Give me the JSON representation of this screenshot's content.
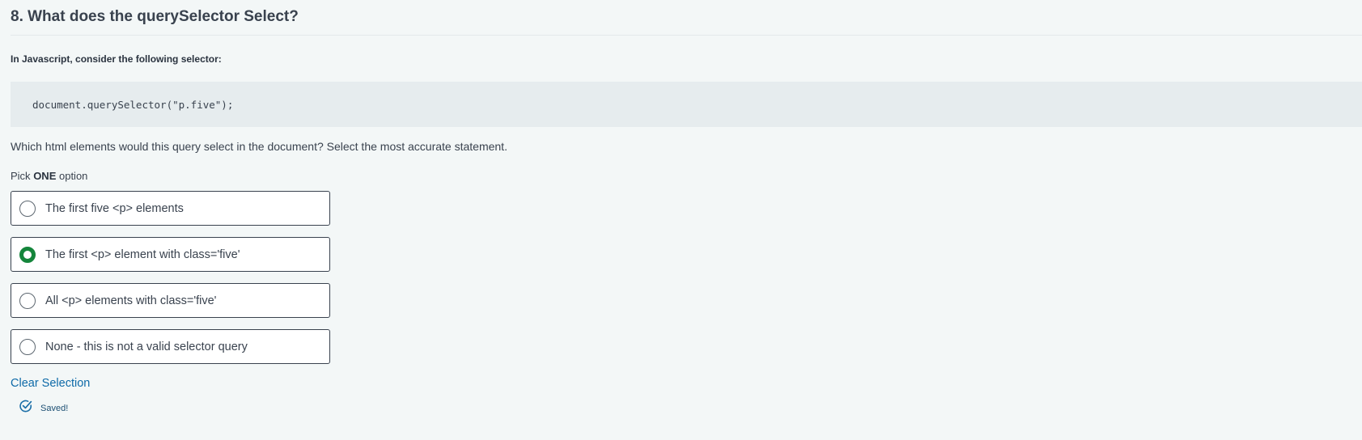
{
  "question": {
    "title": "8. What does the querySelector Select?",
    "intro": "In Javascript, consider the following selector:",
    "code": "document.querySelector(\"p.five\");",
    "prompt": "Which html elements would this query select in the document? Select the most accurate statement.",
    "pick_prefix": "Pick",
    "pick_emphasis": "ONE",
    "pick_suffix": "option"
  },
  "options": [
    {
      "label": "The first five <p> elements",
      "selected": false
    },
    {
      "label": "The first <p> element with class='five'",
      "selected": true
    },
    {
      "label": "All <p> elements with class='five'",
      "selected": false
    },
    {
      "label": "None - this is not a valid selector query",
      "selected": false
    }
  ],
  "actions": {
    "clear_label": "Clear Selection"
  },
  "status": {
    "saved_label": "Saved!",
    "icon": "check-circle-icon"
  },
  "colors": {
    "accent_green": "#14853b",
    "link_blue": "#0e6aa8",
    "text": "#39424e",
    "background": "#f3f7f7",
    "code_background": "#e6ecee"
  }
}
